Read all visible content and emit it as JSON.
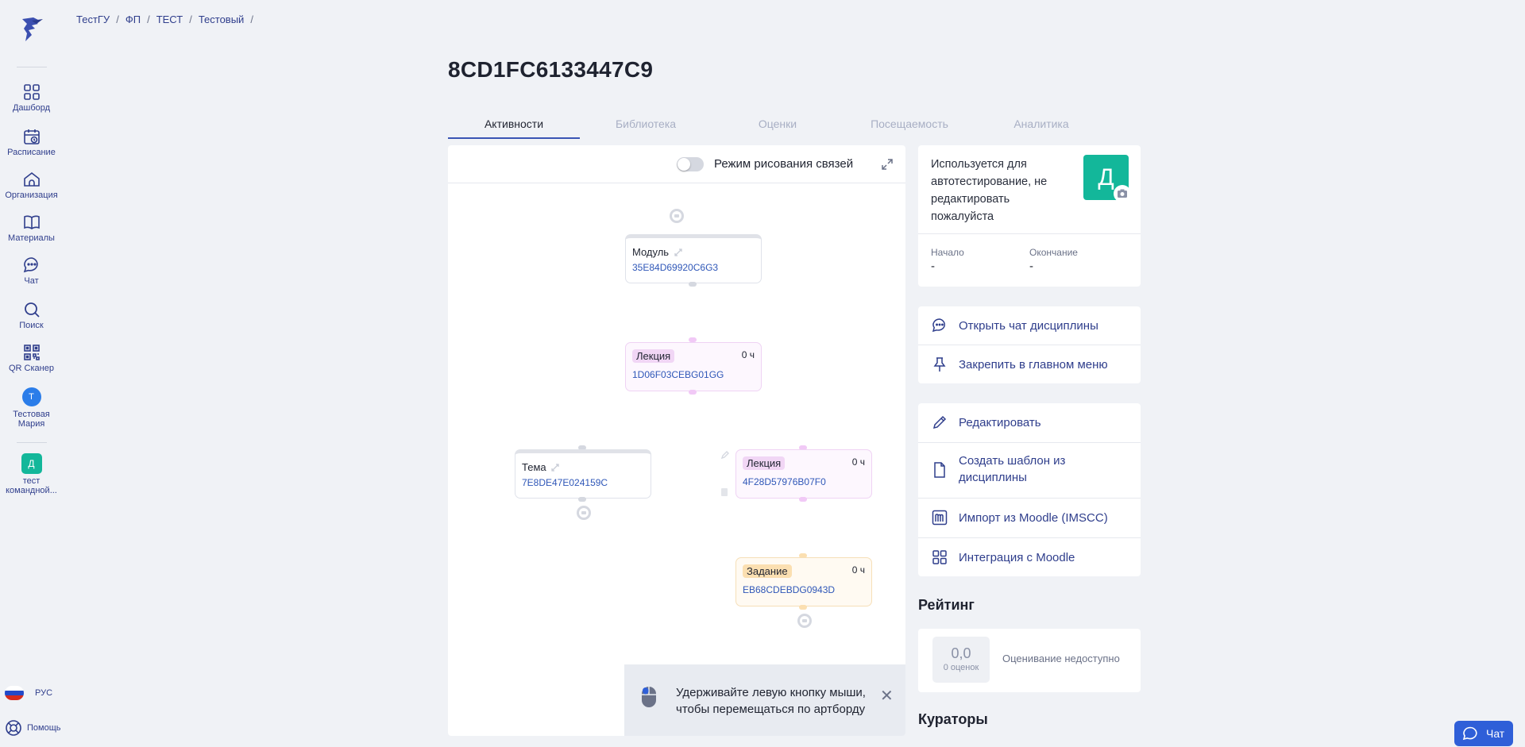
{
  "sidebar": {
    "items": [
      {
        "label": "Дашборд",
        "icon": "dashboard-icon"
      },
      {
        "label": "Расписание",
        "icon": "schedule-icon"
      },
      {
        "label": "Организация",
        "icon": "organization-icon"
      },
      {
        "label": "Материалы",
        "icon": "book-icon"
      },
      {
        "label": "Чат",
        "icon": "chat-icon"
      },
      {
        "label": "Поиск",
        "icon": "search-icon"
      },
      {
        "label": "QR Сканер",
        "icon": "qr-icon"
      }
    ],
    "user": {
      "initial": "Т",
      "name_line1": "Тестовая",
      "name_line2": "Мария"
    },
    "workspace": {
      "initial": "Д",
      "name_line1": "тест",
      "name_line2": "командной..."
    },
    "language": "РУС",
    "help": "Помощь"
  },
  "breadcrumb": [
    "ТестГУ",
    "ФП",
    "ТЕСТ",
    "Тестовый"
  ],
  "page_title": "8CD1FC6133447C9",
  "tabs": [
    "Активности",
    "Библиотека",
    "Оценки",
    "Посещаемость",
    "Аналитика"
  ],
  "canvas": {
    "toggle_label": "Режим рисования связей",
    "nodes": [
      {
        "title": "Модуль",
        "code": "35E84D69920C6G3"
      },
      {
        "badge": "Лекция",
        "hours": "0 ч",
        "code": "1D06F03CEBG01GG"
      },
      {
        "title": "Тема",
        "code": "7E8DE47E024159C"
      },
      {
        "badge": "Лекция",
        "hours": "0 ч",
        "code": "4F28D57976B07F0"
      },
      {
        "badge": "Задание",
        "hours": "0 ч",
        "code": "EB68CDEBDG0943D"
      }
    ],
    "hint_line1": "Удерживайте левую кнопку мыши,",
    "hint_line2": "чтобы перемещаться по артборду",
    "hint_close": "✕"
  },
  "info": {
    "description": "Используется для автотестирование, не редактировать пожалуйста",
    "avatar_initial": "Д",
    "start_label": "Начало",
    "start_value": "-",
    "end_label": "Окончание",
    "end_value": "-"
  },
  "actions1": [
    "Открыть чат дисциплины",
    "Закрепить в главном меню"
  ],
  "actions2": [
    "Редактировать",
    "Создать шаблон из",
    "дисциплины",
    "Импорт из Moodle (IMSCC)",
    "Интеграция с Moodle"
  ],
  "rating": {
    "title": "Рейтинг",
    "score": "0,0",
    "count": "0 оценок",
    "status": "Оценивание недоступно"
  },
  "curators_title": "Кураторы",
  "chat_button": "Чат",
  "colors": {
    "accent": "#2f3e8c",
    "teal": "#13b79a",
    "chat_blue": "#2f5fd8"
  }
}
